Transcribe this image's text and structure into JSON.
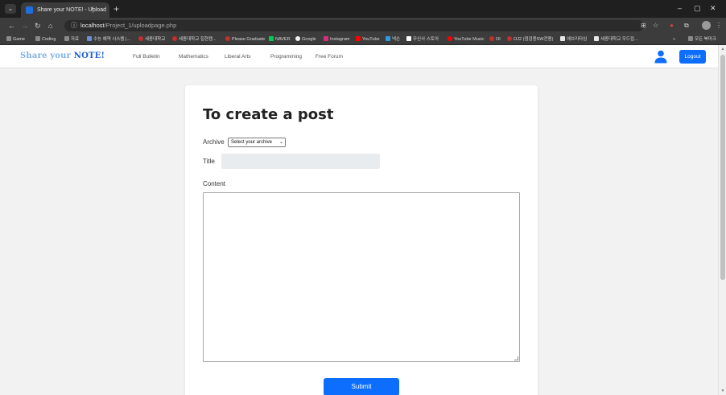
{
  "browser": {
    "tab_title": "Share your NOTE! - Upload",
    "tab_close": "×",
    "new_tab": "+",
    "window_controls": [
      "–",
      "▢",
      "✕"
    ],
    "url_host": "localhost",
    "url_path": "/Project_1/uploadpage.php",
    "bookmarks": [
      "Game",
      "Coding",
      "자료",
      "수능 예약 시스템 |...",
      "세종대학교",
      "세종대학교 집현캠...",
      "Please Graduate",
      "NAVER",
      "Google",
      "Instagram",
      "YouTube",
      "넥슨",
      "무신사 스토어",
      "YouTube Music",
      "OI",
      "OJ2 (점검용SW전용)",
      "에브리타임",
      "세종대학교 우드립..."
    ],
    "bookmarks_overflow": "»",
    "all_bookmarks": "모든 북마크"
  },
  "site": {
    "brand_prefix": "Share your ",
    "brand_note": "NOTE",
    "brand_suffix": "!",
    "nav": [
      "Full Bulletin",
      "Mathematics",
      "Liberal Arts",
      "Programming",
      "Free Forum"
    ],
    "logout_label": "Logout"
  },
  "form": {
    "heading": "To create a post",
    "archive_label": "Archive",
    "archive_selected": "Select your archive",
    "title_label": "Title",
    "title_value": "",
    "content_label": "Content",
    "content_value": "",
    "submit_label": "Submit"
  },
  "colors": {
    "primary": "#0d6efd",
    "brand_light": "#7fb0e6",
    "brand_dark": "#1f5fd0"
  }
}
